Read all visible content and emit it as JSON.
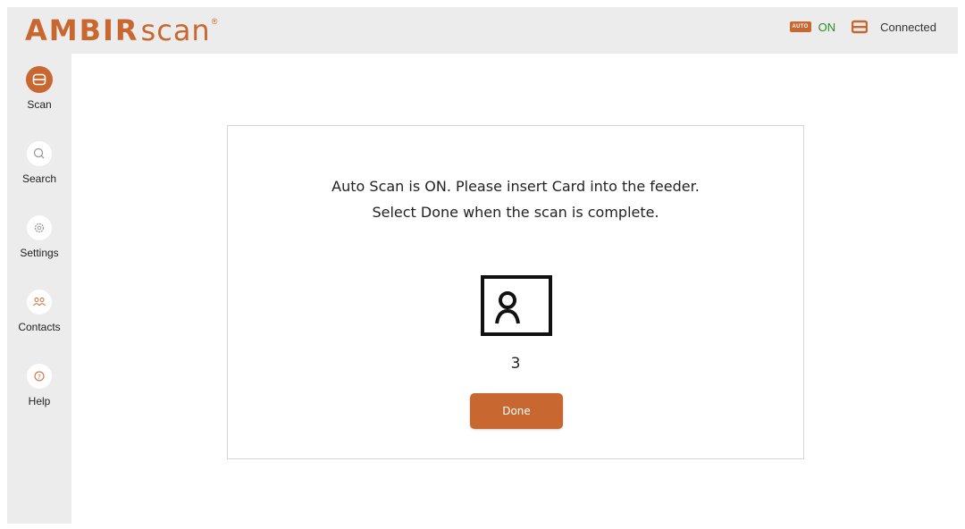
{
  "header": {
    "logo_bold": "AMBIR",
    "logo_light": "scan",
    "logo_mark": "®",
    "auto_badge": "AUTO",
    "auto_status": "ON",
    "connection_status": "Connected"
  },
  "sidebar": {
    "items": [
      {
        "label": "Scan",
        "icon": "scan-icon",
        "active": true
      },
      {
        "label": "Search",
        "icon": "search-icon",
        "active": false
      },
      {
        "label": "Settings",
        "icon": "gear-icon",
        "active": false
      },
      {
        "label": "Contacts",
        "icon": "contacts-icon",
        "active": false
      },
      {
        "label": "Help",
        "icon": "help-icon",
        "active": false
      }
    ]
  },
  "main": {
    "message_line1": "Auto Scan is ON. Please insert Card into the feeder.",
    "message_line2": "Select Done when the scan is complete.",
    "card_icon": "id-card-icon",
    "countdown": "3",
    "done_label": "Done"
  },
  "colors": {
    "accent": "#c8672f",
    "on_green": "#2a8a2a",
    "panel_bg": "#ececec"
  }
}
